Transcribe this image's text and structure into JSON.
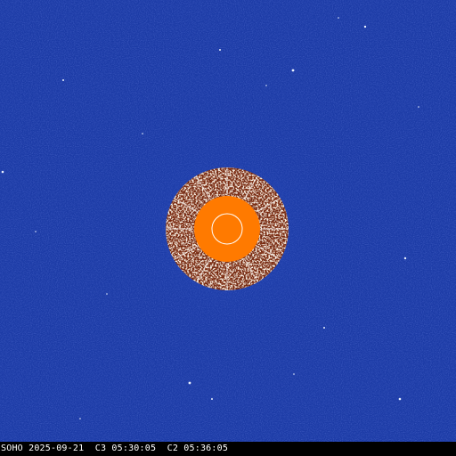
{
  "caption": "SOHO 2025-09-21  C3 05:30:05  C2 05:36:05",
  "colors": {
    "background": "#1c3ba6",
    "sun": "#ff7a00",
    "inner_ring": "#ffffff",
    "occulter_ring": "#f2e6d2"
  }
}
